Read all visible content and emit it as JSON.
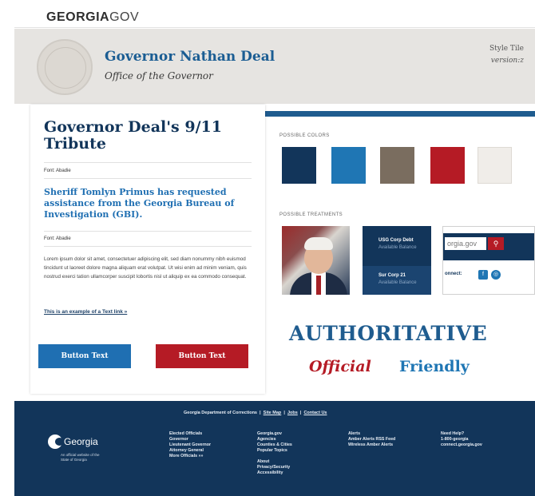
{
  "topbar": {
    "brand_bold": "GEORGIA",
    "brand_light": "GOV"
  },
  "header": {
    "title": "Governor Nathan Deal",
    "subtitle": "Office of the Governor",
    "style_tile": "Style Tile",
    "version": "version:z"
  },
  "content": {
    "heading": "Governor Deal's 9/11 Tribute",
    "font_label_1": "Font: Abadie",
    "subheading": "Sheriff Tomlyn Primus has requested assistance from the Georgia Bureau of Investigation (GBI).",
    "font_label_2": "Font: Abadie",
    "body": "Lorem ipsum dolor sit amet, consectetuer adipiscing elit, sed diam nonummy nibh euismod tincidunt ut laoreet dolore magna aliquam erat volutpat. Ut wisi enim ad minim veniam, quis nostrud exerci tation ullamcorper suscipit lobortis nisl ut aliquip ex ea commodo consequat.",
    "text_link": "This is an example of a Text link »",
    "button_blue": "Button Text",
    "button_red": "Button Text"
  },
  "colors_section": {
    "label": "POSSIBLE COLORS",
    "swatches": [
      "#12355a",
      "#1f76b4",
      "#7a6d5f",
      "#b51b25",
      "#f0ede9"
    ]
  },
  "treatments_section": {
    "label": "POSSIBLE TREATMENTS",
    "panel_row1_title": "USG Corp Debt",
    "panel_row1_sub": "Available Balance",
    "panel_row2_title": "Sur Corp 21",
    "panel_row2_sub": "Available Balance",
    "search_value": "orgia.gov",
    "search_icon": "search-icon",
    "connect": "onnect:"
  },
  "tagline": {
    "authoritative": "AUTHORITATIVE",
    "official": "Official",
    "friendly": "Friendly"
  },
  "footer": {
    "links_prefix": "Georgia Department of Corrections",
    "links": [
      "Site Map",
      "Jobs",
      "Contact Us"
    ],
    "logo_text": "Georgia",
    "logo_tag": "An official website of the State of Georgia",
    "col1": [
      "Elected Officials",
      "Governor",
      "Lieutenant Governor",
      "Attorney General",
      "More Officials »»"
    ],
    "col2a": [
      "Georgia.gov",
      "Agencies",
      "Counties & Cities",
      "Popular Topics"
    ],
    "col2b": [
      "About",
      "Privacy/Security",
      "Accessibility"
    ],
    "col3": [
      "Alerts",
      "Amber Alerts RSS Feed",
      "Wireless Amber Alerts"
    ],
    "col4": [
      "Need Help?",
      "1-800-georgia",
      "connect.georgia.gov"
    ]
  }
}
